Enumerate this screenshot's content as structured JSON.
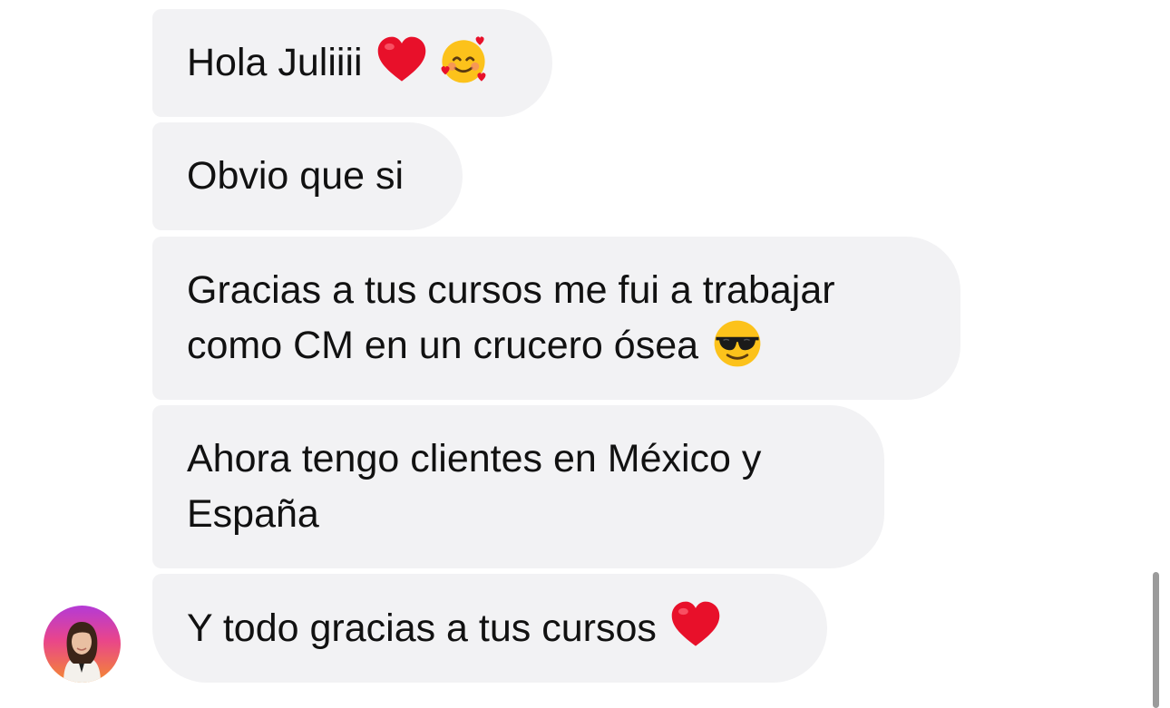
{
  "messages": [
    {
      "text": "Hola Juliiii",
      "emojis": [
        "red-heart",
        "smiling-face-with-hearts"
      ]
    },
    {
      "text": "Obvio que si",
      "emojis": []
    },
    {
      "text": "Gracias a tus cursos me fui a trabajar como CM en un crucero ósea",
      "emojis": [
        "smiling-face-with-sunglasses"
      ]
    },
    {
      "text": "Ahora tengo clientes en México y España",
      "emojis": []
    },
    {
      "text": "Y todo gracias a tus cursos",
      "emojis": [
        "red-heart"
      ]
    }
  ],
  "colors": {
    "bubble_background": "#f2f2f4",
    "text": "#111111",
    "scrollbar": "#9b9b9b"
  },
  "sender": {
    "avatar": "profile-photo"
  }
}
